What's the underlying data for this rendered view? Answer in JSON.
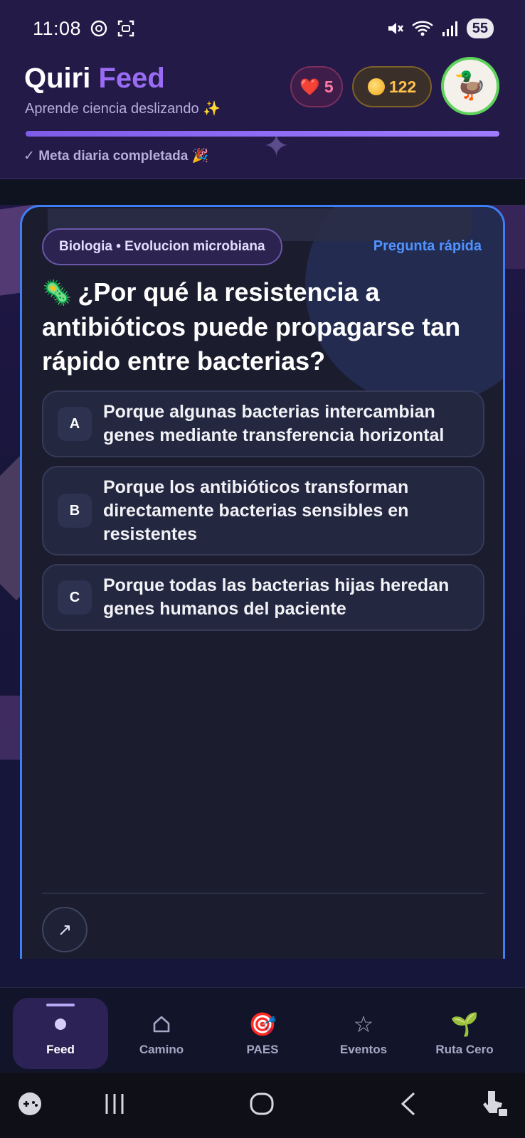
{
  "status_bar": {
    "time": "11:08",
    "battery": "55",
    "icons": [
      "openai-icon",
      "screenshot-icon",
      "mute-icon",
      "wifi-icon",
      "signal-icon"
    ]
  },
  "header": {
    "brand_part1": "Quiri",
    "brand_part2": "Feed",
    "tagline": "Aprende ciencia deslizando ✨",
    "hearts": "5",
    "coins": "122",
    "avatar_emoji": "🦆",
    "goal_text": "✓ Meta diaria completada 🎉",
    "progress": 1.0,
    "colors": {
      "accent": "#9a6cf5",
      "card_border": "#3e7ff5"
    }
  },
  "card": {
    "tag": "Biologia • Evolucion microbiana",
    "quick_label": "Pregunta rápida",
    "question_icon": "🦠",
    "question": "¿Por qué la resistencia a antibióticos puede propagarse tan rápido entre bacterias?",
    "options": [
      {
        "letter": "A",
        "text": "Porque algunas bacterias intercambian genes mediante transferencia horizontal"
      },
      {
        "letter": "B",
        "text": "Porque los antibióticos transforman directamente bacterias sensibles en resistentes"
      },
      {
        "letter": "C",
        "text": "Porque todas las bacterias hijas heredan genes humanos del paciente"
      }
    ],
    "share_icon": "↗"
  },
  "nav": {
    "items": [
      {
        "label": "Feed",
        "icon": "●",
        "active": true
      },
      {
        "label": "Camino",
        "icon": "⌂",
        "active": false
      },
      {
        "label": "PAES",
        "icon": "🎯",
        "active": false
      },
      {
        "label": "Eventos",
        "icon": "☆",
        "active": false
      },
      {
        "label": "Ruta Cero",
        "icon": "🌱",
        "active": false
      }
    ]
  }
}
